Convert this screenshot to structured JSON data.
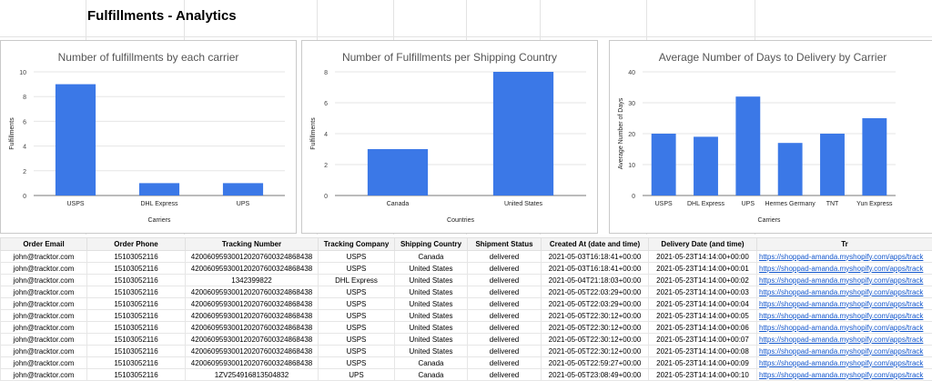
{
  "page": {
    "title": "Fulfillments - Analytics"
  },
  "charts": [
    {
      "type": "bar",
      "title": "Number of fulfillments by each carrier",
      "xlabel": "Carriers",
      "ylabel": "Fulfillments",
      "categories": [
        "USPS",
        "DHL Express",
        "UPS"
      ],
      "values": [
        9,
        1,
        1
      ],
      "ylim": [
        0,
        10
      ],
      "yticks": [
        0,
        2,
        4,
        6,
        8,
        10
      ],
      "color": "#3b78e7"
    },
    {
      "type": "bar",
      "title": "Number of Fulfillments per Shipping Country",
      "xlabel": "Countries",
      "ylabel": "Fulfillments",
      "categories": [
        "Canada",
        "United States"
      ],
      "values": [
        3,
        8
      ],
      "ylim": [
        0,
        8
      ],
      "yticks": [
        0,
        2,
        4,
        6,
        8
      ],
      "color": "#3b78e7"
    },
    {
      "type": "bar",
      "title": "Average Number of Days to Delivery by Carrier",
      "xlabel": "Carriers",
      "ylabel": "Average Number of Days",
      "categories": [
        "USPS",
        "DHL Express",
        "UPS",
        "Hermes Germany",
        "TNT",
        "Yun Express"
      ],
      "values": [
        20,
        19,
        32,
        17,
        20,
        25
      ],
      "ylim": [
        0,
        40
      ],
      "yticks": [
        0,
        10,
        20,
        30,
        40
      ],
      "color": "#3b78e7"
    }
  ],
  "table": {
    "headers": [
      "Order Email",
      "Order Phone",
      "Tracking Number",
      "Tracking Company",
      "Shipping Country",
      "Shipment Status",
      "Created At (date and time)",
      "Delivery Date (and time)",
      "Tr"
    ],
    "rows": [
      [
        "john@tracktor.com",
        "15103052116",
        "420060959300120207600324868438",
        "USPS",
        "Canada",
        "delivered",
        "2021-05-03T16:18:41+00:00",
        "2021-05-23T14:14:00+00:00",
        "https://shoppad-amanda.myshopify.com/apps/track"
      ],
      [
        "john@tracktor.com",
        "15103052116",
        "420060959300120207600324868438",
        "USPS",
        "United States",
        "delivered",
        "2021-05-03T16:18:41+00:00",
        "2021-05-23T14:14:00+00:01",
        "https://shoppad-amanda.myshopify.com/apps/track"
      ],
      [
        "john@tracktor.com",
        "15103052116",
        "1342399822",
        "DHL Express",
        "United States",
        "delivered",
        "2021-05-04T21:18:03+00:00",
        "2021-05-23T14:14:00+00:02",
        "https://shoppad-amanda.myshopify.com/apps/track"
      ],
      [
        "john@tracktor.com",
        "15103052116",
        "420060959300120207600324868438",
        "USPS",
        "United States",
        "delivered",
        "2021-05-05T22:03:29+00:00",
        "2021-05-23T14:14:00+00:03",
        "https://shoppad-amanda.myshopify.com/apps/track"
      ],
      [
        "john@tracktor.com",
        "15103052116",
        "420060959300120207600324868438",
        "USPS",
        "United States",
        "delivered",
        "2021-05-05T22:03:29+00:00",
        "2021-05-23T14:14:00+00:04",
        "https://shoppad-amanda.myshopify.com/apps/track"
      ],
      [
        "john@tracktor.com",
        "15103052116",
        "420060959300120207600324868438",
        "USPS",
        "United States",
        "delivered",
        "2021-05-05T22:30:12+00:00",
        "2021-05-23T14:14:00+00:05",
        "https://shoppad-amanda.myshopify.com/apps/track"
      ],
      [
        "john@tracktor.com",
        "15103052116",
        "420060959300120207600324868438",
        "USPS",
        "United States",
        "delivered",
        "2021-05-05T22:30:12+00:00",
        "2021-05-23T14:14:00+00:06",
        "https://shoppad-amanda.myshopify.com/apps/track"
      ],
      [
        "john@tracktor.com",
        "15103052116",
        "420060959300120207600324868438",
        "USPS",
        "United States",
        "delivered",
        "2021-05-05T22:30:12+00:00",
        "2021-05-23T14:14:00+00:07",
        "https://shoppad-amanda.myshopify.com/apps/track"
      ],
      [
        "john@tracktor.com",
        "15103052116",
        "420060959300120207600324868438",
        "USPS",
        "United States",
        "delivered",
        "2021-05-05T22:30:12+00:00",
        "2021-05-23T14:14:00+00:08",
        "https://shoppad-amanda.myshopify.com/apps/track"
      ],
      [
        "john@tracktor.com",
        "15103052116",
        "420060959300120207600324868438",
        "USPS",
        "Canada",
        "delivered",
        "2021-05-05T22:59:27+00:00",
        "2021-05-23T14:14:00+00:09",
        "https://shoppad-amanda.myshopify.com/apps/track"
      ],
      [
        "john@tracktor.com",
        "15103052116",
        "1ZV254916813504832",
        "UPS",
        "Canada",
        "delivered",
        "2021-05-05T23:08:49+00:00",
        "2021-05-23T14:14:00+00:10",
        "https://shoppad-amanda.myshopify.com/apps/track"
      ]
    ]
  }
}
